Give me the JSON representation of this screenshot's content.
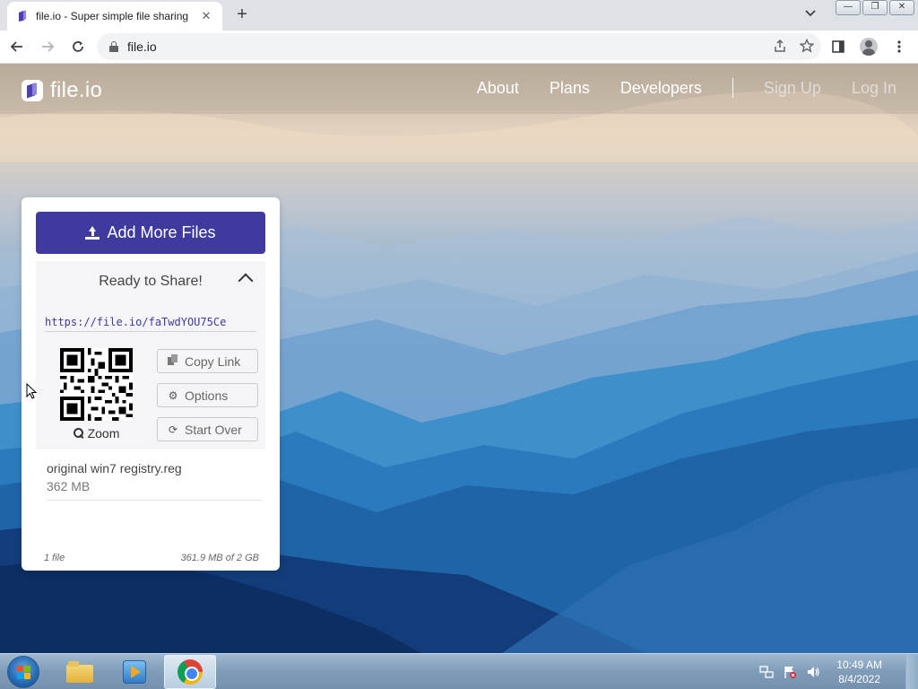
{
  "browser": {
    "tab_title": "file.io - Super simple file sharing",
    "url": "file.io"
  },
  "site": {
    "logo": "file.io",
    "nav": [
      "About",
      "Plans",
      "Developers"
    ],
    "auth": [
      "Sign Up",
      "Log In"
    ]
  },
  "uploader": {
    "add_button": "Add More Files",
    "ready_label": "Ready to Share!",
    "share_link": "https://file.io/faTwdYOU75Ce",
    "zoom_label": "Zoom",
    "actions": {
      "copy": "Copy Link",
      "options": "Options",
      "start_over": "Start Over"
    },
    "file": {
      "name": "original win7 registry.reg",
      "size": "362 MB"
    },
    "footer": {
      "count": "1 file",
      "usage": "361.9 MB of 2 GB"
    }
  },
  "taskbar": {
    "time": "10:49 AM",
    "date": "8/4/2022"
  },
  "colors": {
    "brand": "#3f3a9e",
    "link": "#3f3a9e"
  }
}
